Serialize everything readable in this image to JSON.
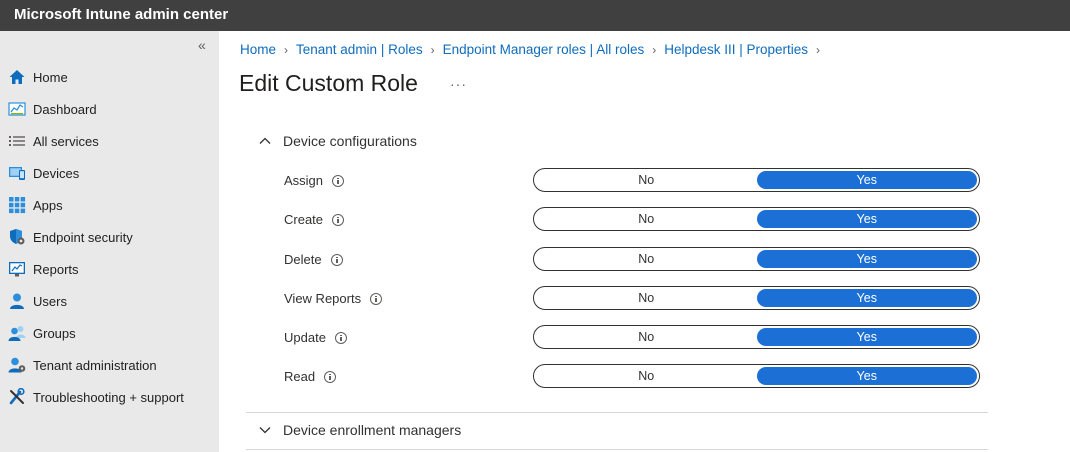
{
  "app": {
    "title": "Microsoft Intune admin center"
  },
  "sidebar": {
    "collapse_glyph": "«",
    "items": [
      {
        "label": "Home",
        "icon": "home-icon"
      },
      {
        "label": "Dashboard",
        "icon": "dashboard-icon"
      },
      {
        "label": "All services",
        "icon": "all-services-icon"
      },
      {
        "label": "Devices",
        "icon": "devices-icon"
      },
      {
        "label": "Apps",
        "icon": "apps-icon"
      },
      {
        "label": "Endpoint security",
        "icon": "endpoint-security-icon"
      },
      {
        "label": "Reports",
        "icon": "reports-icon"
      },
      {
        "label": "Users",
        "icon": "users-icon"
      },
      {
        "label": "Groups",
        "icon": "groups-icon"
      },
      {
        "label": "Tenant administration",
        "icon": "tenant-administration-icon"
      },
      {
        "label": "Troubleshooting + support",
        "icon": "troubleshooting-icon"
      }
    ]
  },
  "breadcrumb": {
    "items": [
      "Home",
      "Tenant admin | Roles",
      "Endpoint Manager roles | All roles",
      "Helpdesk III | Properties"
    ],
    "separator": "›"
  },
  "page": {
    "title": "Edit Custom Role",
    "more": "···"
  },
  "sections": [
    {
      "label": "Device configurations",
      "expanded": true,
      "permissions": [
        {
          "label": "Assign",
          "no": "No",
          "yes": "Yes",
          "selected": "Yes"
        },
        {
          "label": "Create",
          "no": "No",
          "yes": "Yes",
          "selected": "Yes"
        },
        {
          "label": "Delete",
          "no": "No",
          "yes": "Yes",
          "selected": "Yes"
        },
        {
          "label": "View Reports",
          "no": "No",
          "yes": "Yes",
          "selected": "Yes"
        },
        {
          "label": "Update",
          "no": "No",
          "yes": "Yes",
          "selected": "Yes"
        },
        {
          "label": "Read",
          "no": "No",
          "yes": "Yes",
          "selected": "Yes"
        }
      ]
    },
    {
      "label": "Device enrollment managers",
      "expanded": false
    }
  ],
  "colors": {
    "topbar": "#404040",
    "sidebar": "#e9e9e9",
    "accent": "#1c6fd4",
    "link": "#0f6cbd"
  }
}
